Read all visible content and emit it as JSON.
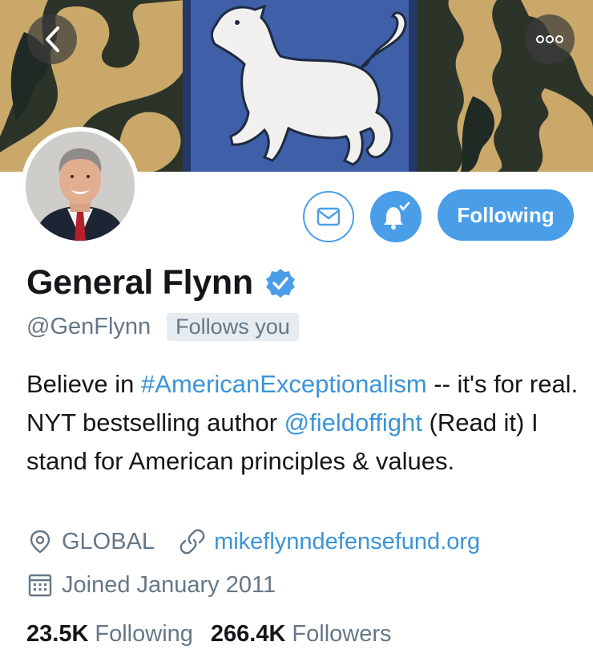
{
  "banner": {
    "back_icon": "chevron-left-icon",
    "more_icon": "more-dots-icon"
  },
  "profile": {
    "name": "General Flynn",
    "handle": "@GenFlynn",
    "follows_you": "Follows you",
    "bio": {
      "part1": "Believe in ",
      "hashtag": "#AmericanExceptionalism",
      "part2": " -- it's for real. NYT bestselling author ",
      "mention": "@fieldoffight",
      "part3": " (Read it) I stand for American principles & values."
    },
    "location": "GLOBAL",
    "website": "mikeflynndefensefund.org",
    "joined": "Joined January 2011",
    "following_count": "23.5K",
    "following_label": "Following",
    "followers_count": "266.4K",
    "followers_label": "Followers"
  },
  "actions": {
    "message_icon": "envelope-icon",
    "notify_icon": "bell-check-icon",
    "follow_label": "Following"
  },
  "colors": {
    "accent": "#4a9ee8",
    "link": "#3b94d9",
    "secondary_text": "#657786"
  }
}
